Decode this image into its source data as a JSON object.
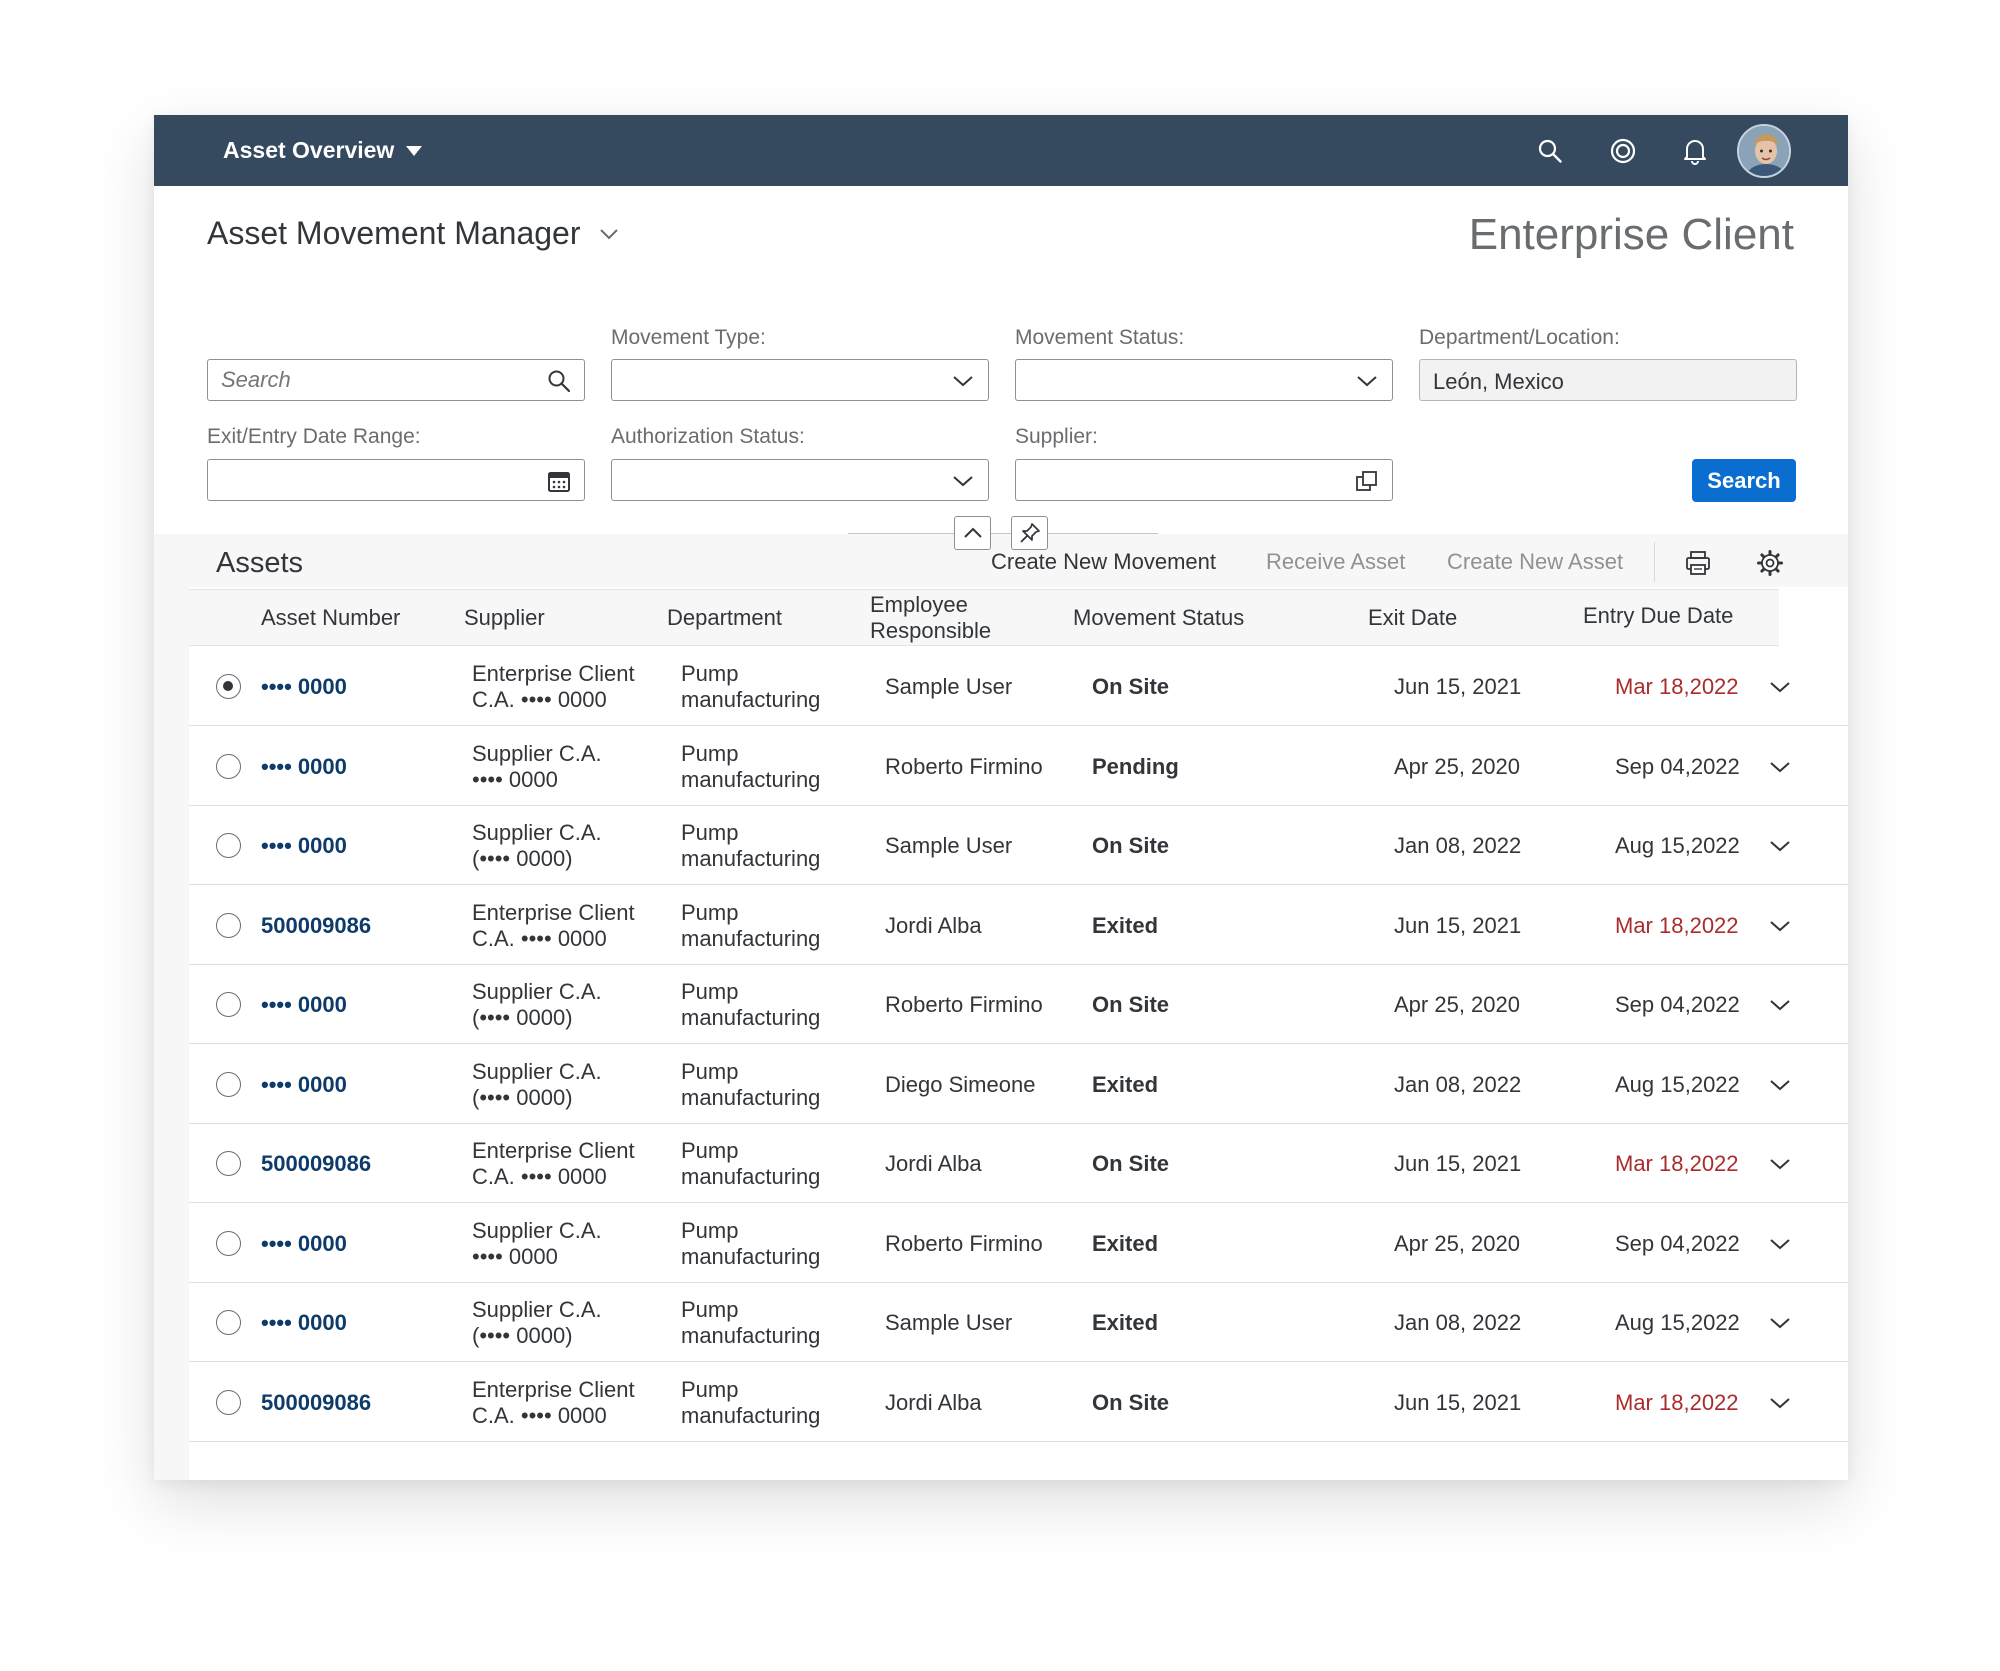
{
  "shell": {
    "title": "Asset Overview",
    "icons": [
      "search-icon",
      "co-pilot-icon",
      "bell-icon",
      "user-avatar"
    ]
  },
  "header": {
    "title": "Asset Movement Manager",
    "client": "Enterprise Client"
  },
  "filters": {
    "search_placeholder": "Search",
    "movement_type_label": "Movement Type:",
    "movement_status_label": "Movement Status:",
    "department_label": "Department/Location:",
    "department_value": "León, Mexico",
    "date_range_label": "Exit/Entry Date Range:",
    "authorization_label": "Authorization Status:",
    "supplier_label": "Supplier:",
    "search_button": "Search"
  },
  "table": {
    "title": "Assets",
    "actions": {
      "create_movement": "Create New Movement",
      "receive_asset": "Receive Asset",
      "create_asset": "Create New Asset"
    },
    "columns": {
      "asset_number": "Asset Number",
      "supplier": "Supplier",
      "department": "Department",
      "employee_1": "Employee",
      "employee_2": "Responsible",
      "movement_status": "Movement Status",
      "exit_date": "Exit Date",
      "entry_due_date": "Entry Due Date"
    },
    "rows": [
      {
        "asset": "•••• 0000",
        "supplier_1": "Enterprise Client",
        "supplier_2": "C.A. •••• 0000",
        "dept_1": "Pump",
        "dept_2": "manufacturing",
        "employee": "Sample User",
        "status": "On Site",
        "exit": "Jun 15, 2021",
        "due": "Mar 18,2022",
        "due_overdue": true,
        "selected": true
      },
      {
        "asset": "•••• 0000",
        "supplier_1": "Supplier C.A.",
        "supplier_2": "•••• 0000",
        "dept_1": "Pump",
        "dept_2": "manufacturing",
        "employee": "Roberto Firmino",
        "status": "Pending",
        "exit": "Apr 25, 2020",
        "due": "Sep 04,2022",
        "due_overdue": false,
        "selected": false
      },
      {
        "asset": "•••• 0000",
        "supplier_1": "Supplier C.A.",
        "supplier_2": "(•••• 0000)",
        "dept_1": "Pump",
        "dept_2": "manufacturing",
        "employee": "Sample User",
        "status": "On Site",
        "exit": "Jan 08, 2022",
        "due": "Aug 15,2022",
        "due_overdue": false,
        "selected": false
      },
      {
        "asset": "500009086",
        "supplier_1": "Enterprise Client",
        "supplier_2": "C.A. •••• 0000",
        "dept_1": "Pump",
        "dept_2": "manufacturing",
        "employee": "Jordi Alba",
        "status": "Exited",
        "exit": "Jun 15, 2021",
        "due": "Mar 18,2022",
        "due_overdue": true,
        "selected": false
      },
      {
        "asset": "•••• 0000",
        "supplier_1": "Supplier C.A.",
        "supplier_2": "(•••• 0000)",
        "dept_1": "Pump",
        "dept_2": "manufacturing",
        "employee": "Roberto Firmino",
        "status": "On Site",
        "exit": "Apr 25, 2020",
        "due": "Sep 04,2022",
        "due_overdue": false,
        "selected": false
      },
      {
        "asset": "•••• 0000",
        "supplier_1": "Supplier C.A.",
        "supplier_2": "(•••• 0000)",
        "dept_1": "Pump",
        "dept_2": "manufacturing",
        "employee": "Diego Simeone",
        "status": "Exited",
        "exit": "Jan 08, 2022",
        "due": "Aug 15,2022",
        "due_overdue": false,
        "selected": false
      },
      {
        "asset": "500009086",
        "supplier_1": "Enterprise Client",
        "supplier_2": "C.A. •••• 0000",
        "dept_1": "Pump",
        "dept_2": "manufacturing",
        "employee": "Jordi Alba",
        "status": "On Site",
        "exit": "Jun 15, 2021",
        "due": "Mar 18,2022",
        "due_overdue": true,
        "selected": false
      },
      {
        "asset": "•••• 0000",
        "supplier_1": "Supplier C.A.",
        "supplier_2": "•••• 0000",
        "dept_1": "Pump",
        "dept_2": "manufacturing",
        "employee": "Roberto Firmino",
        "status": "Exited",
        "exit": "Apr 25, 2020",
        "due": "Sep 04,2022",
        "due_overdue": false,
        "selected": false
      },
      {
        "asset": "•••• 0000",
        "supplier_1": "Supplier C.A.",
        "supplier_2": "(•••• 0000)",
        "dept_1": "Pump",
        "dept_2": "manufacturing",
        "employee": "Sample User",
        "status": "Exited",
        "exit": "Jan 08, 2022",
        "due": "Aug 15,2022",
        "due_overdue": false,
        "selected": false
      },
      {
        "asset": "500009086",
        "supplier_1": "Enterprise Client",
        "supplier_2": "C.A. •••• 0000",
        "dept_1": "Pump",
        "dept_2": "manufacturing",
        "employee": "Jordi Alba",
        "status": "On Site",
        "exit": "Jun 15, 2021",
        "due": "Mar 18,2022",
        "due_overdue": true,
        "selected": false
      }
    ]
  },
  "colors": {
    "shell_bg": "#354a5f",
    "primary_button": "#0a6ed1",
    "link": "#0e3b6a",
    "overdue": "#a92d2d"
  }
}
